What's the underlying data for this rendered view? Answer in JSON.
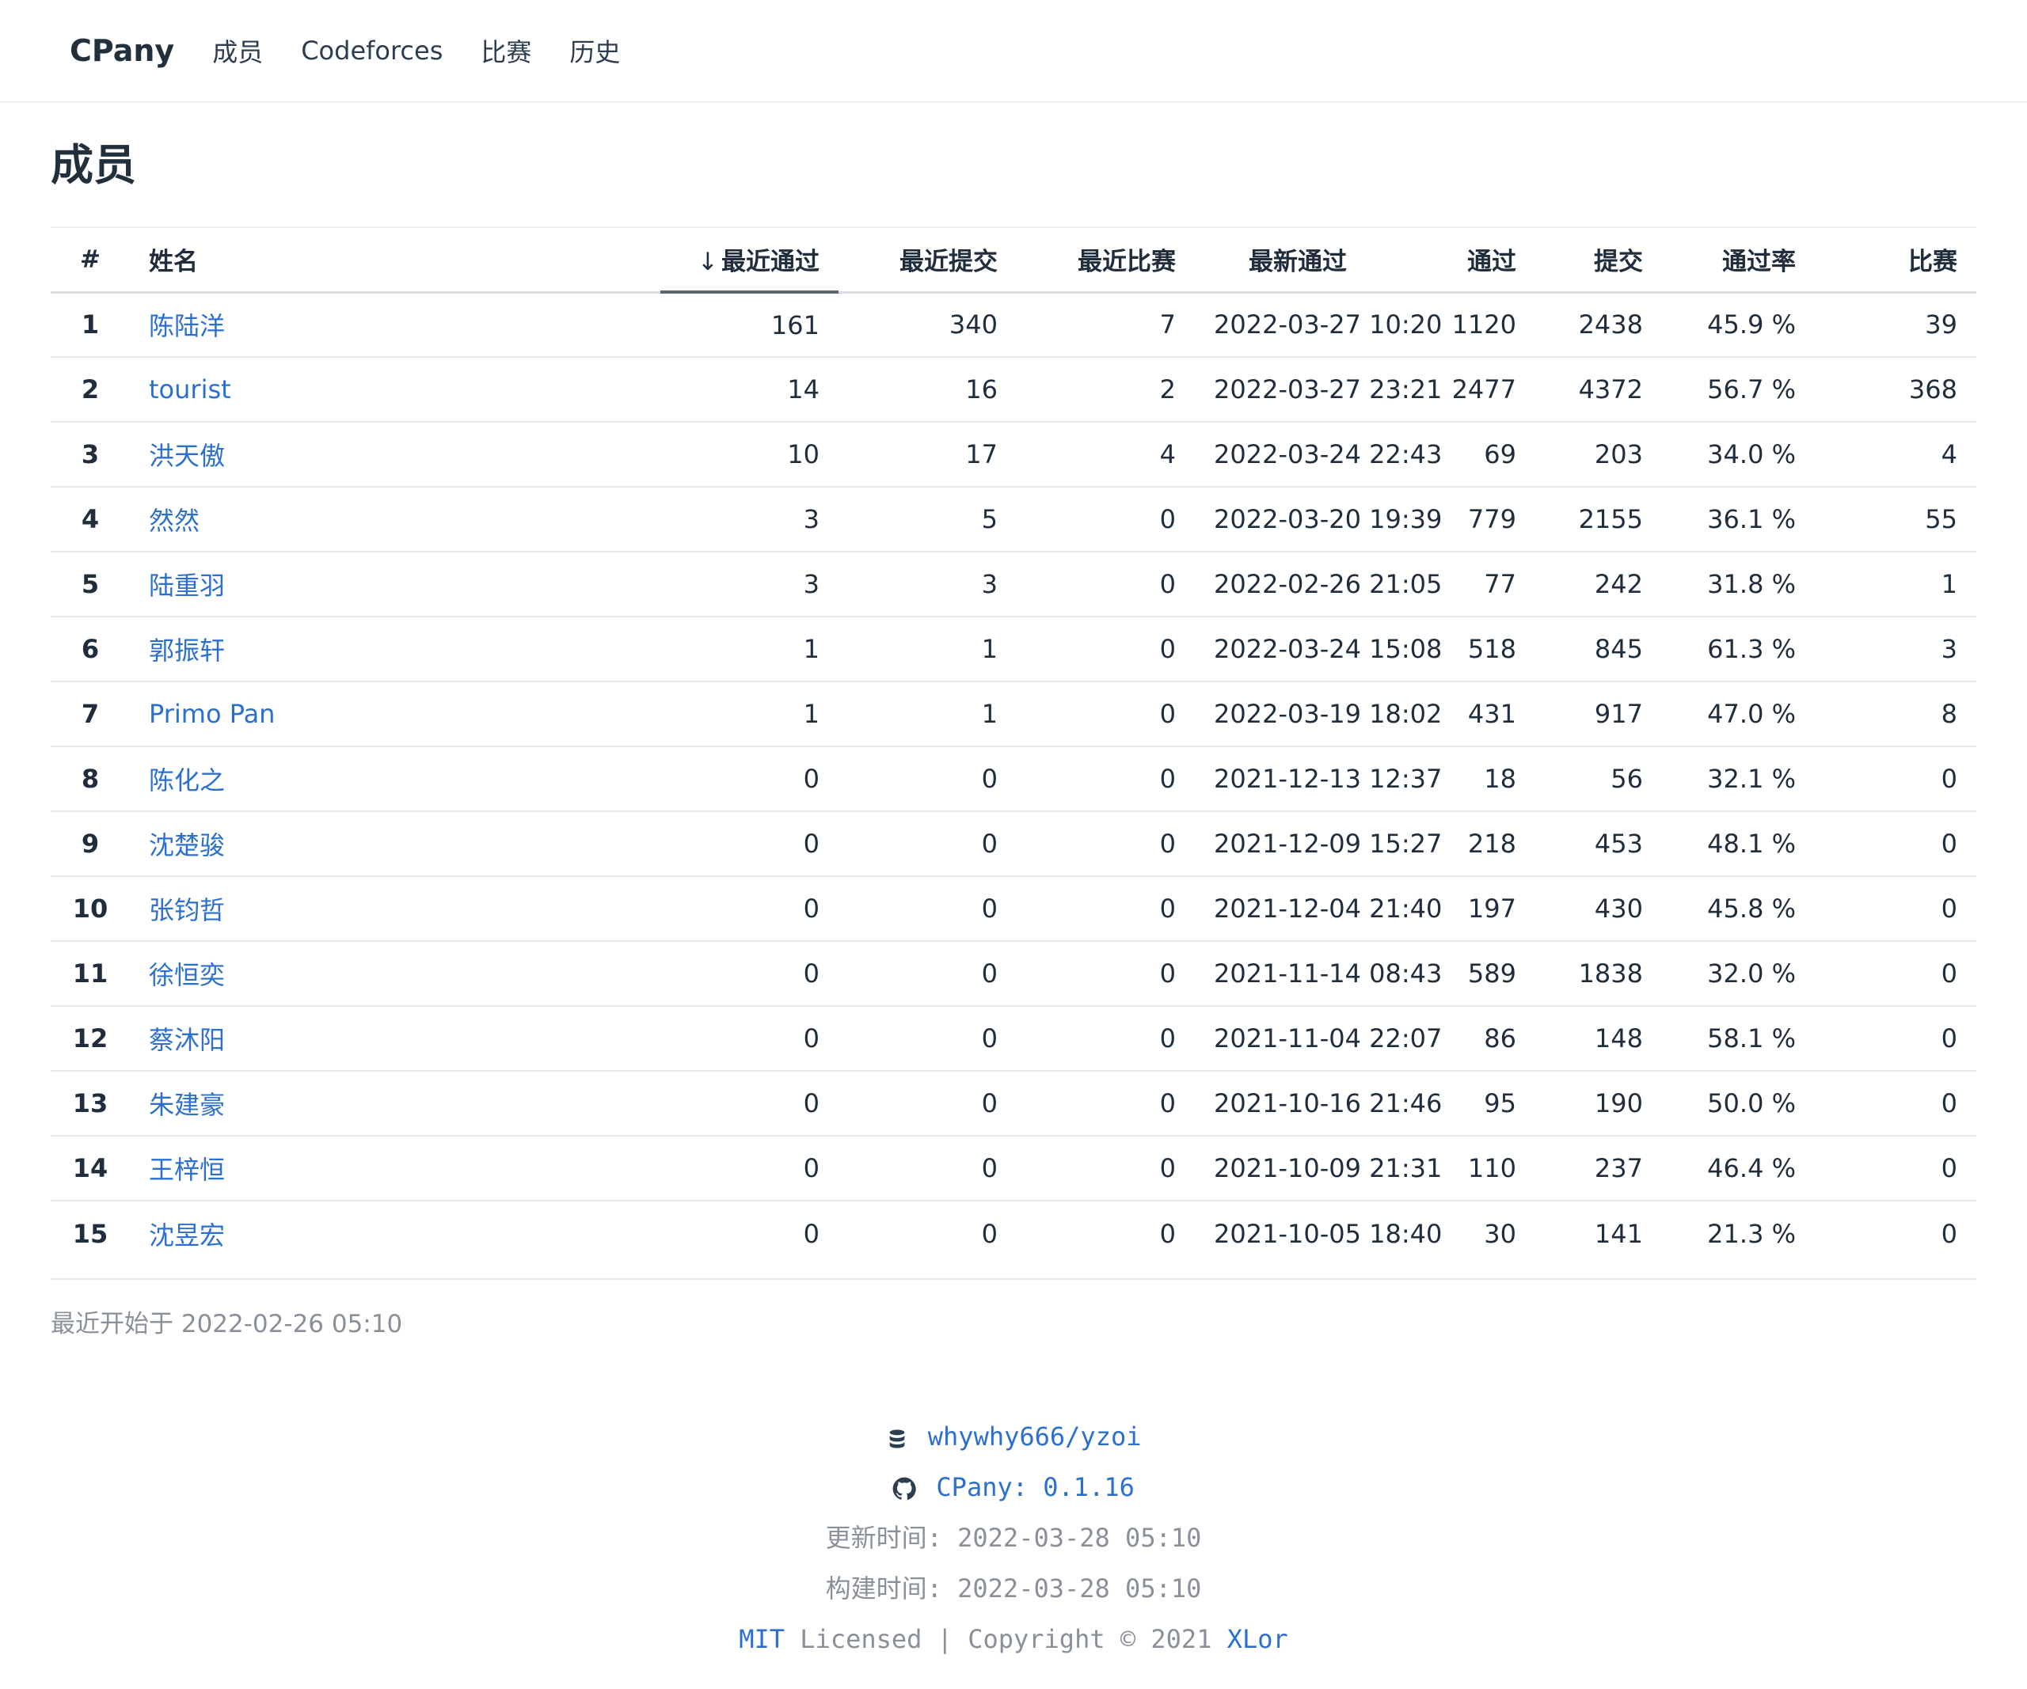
{
  "nav": {
    "brand": "CPany",
    "links": [
      "成员",
      "Codeforces",
      "比赛",
      "历史"
    ]
  },
  "page": {
    "title": "成员"
  },
  "table": {
    "headers": {
      "idx": "#",
      "name": "姓名",
      "recent_ac": "最近通过",
      "recent_submit": "最近提交",
      "recent_contest": "最近比赛",
      "latest_ac_time": "最新通过",
      "ac": "通过",
      "submit": "提交",
      "ac_rate": "通过率",
      "contests": "比赛"
    },
    "sort_arrow": "↓",
    "rows": [
      {
        "idx": "1",
        "name": "陈陆洋",
        "recent_ac": "161",
        "recent_submit": "340",
        "recent_contest": "7",
        "latest": "2022-03-27 10:20",
        "ac": "1120",
        "submit": "2438",
        "rate": "45.9 %",
        "contests": "39"
      },
      {
        "idx": "2",
        "name": "tourist",
        "recent_ac": "14",
        "recent_submit": "16",
        "recent_contest": "2",
        "latest": "2022-03-27 23:21",
        "ac": "2477",
        "submit": "4372",
        "rate": "56.7 %",
        "contests": "368"
      },
      {
        "idx": "3",
        "name": "洪天傲",
        "recent_ac": "10",
        "recent_submit": "17",
        "recent_contest": "4",
        "latest": "2022-03-24 22:43",
        "ac": "69",
        "submit": "203",
        "rate": "34.0 %",
        "contests": "4"
      },
      {
        "idx": "4",
        "name": "然然",
        "recent_ac": "3",
        "recent_submit": "5",
        "recent_contest": "0",
        "latest": "2022-03-20 19:39",
        "ac": "779",
        "submit": "2155",
        "rate": "36.1 %",
        "contests": "55"
      },
      {
        "idx": "5",
        "name": "陆重羽",
        "recent_ac": "3",
        "recent_submit": "3",
        "recent_contest": "0",
        "latest": "2022-02-26 21:05",
        "ac": "77",
        "submit": "242",
        "rate": "31.8 %",
        "contests": "1"
      },
      {
        "idx": "6",
        "name": "郭振轩",
        "recent_ac": "1",
        "recent_submit": "1",
        "recent_contest": "0",
        "latest": "2022-03-24 15:08",
        "ac": "518",
        "submit": "845",
        "rate": "61.3 %",
        "contests": "3"
      },
      {
        "idx": "7",
        "name": "Primo Pan",
        "recent_ac": "1",
        "recent_submit": "1",
        "recent_contest": "0",
        "latest": "2022-03-19 18:02",
        "ac": "431",
        "submit": "917",
        "rate": "47.0 %",
        "contests": "8"
      },
      {
        "idx": "8",
        "name": "陈化之",
        "recent_ac": "0",
        "recent_submit": "0",
        "recent_contest": "0",
        "latest": "2021-12-13 12:37",
        "ac": "18",
        "submit": "56",
        "rate": "32.1 %",
        "contests": "0"
      },
      {
        "idx": "9",
        "name": "沈楚骏",
        "recent_ac": "0",
        "recent_submit": "0",
        "recent_contest": "0",
        "latest": "2021-12-09 15:27",
        "ac": "218",
        "submit": "453",
        "rate": "48.1 %",
        "contests": "0"
      },
      {
        "idx": "10",
        "name": "张钧哲",
        "recent_ac": "0",
        "recent_submit": "0",
        "recent_contest": "0",
        "latest": "2021-12-04 21:40",
        "ac": "197",
        "submit": "430",
        "rate": "45.8 %",
        "contests": "0"
      },
      {
        "idx": "11",
        "name": "徐恒奕",
        "recent_ac": "0",
        "recent_submit": "0",
        "recent_contest": "0",
        "latest": "2021-11-14 08:43",
        "ac": "589",
        "submit": "1838",
        "rate": "32.0 %",
        "contests": "0"
      },
      {
        "idx": "12",
        "name": "蔡沐阳",
        "recent_ac": "0",
        "recent_submit": "0",
        "recent_contest": "0",
        "latest": "2021-11-04 22:07",
        "ac": "86",
        "submit": "148",
        "rate": "58.1 %",
        "contests": "0"
      },
      {
        "idx": "13",
        "name": "朱建豪",
        "recent_ac": "0",
        "recent_submit": "0",
        "recent_contest": "0",
        "latest": "2021-10-16 21:46",
        "ac": "95",
        "submit": "190",
        "rate": "50.0 %",
        "contests": "0"
      },
      {
        "idx": "14",
        "name": "王梓恒",
        "recent_ac": "0",
        "recent_submit": "0",
        "recent_contest": "0",
        "latest": "2021-10-09 21:31",
        "ac": "110",
        "submit": "237",
        "rate": "46.4 %",
        "contests": "0"
      },
      {
        "idx": "15",
        "name": "沈昱宏",
        "recent_ac": "0",
        "recent_submit": "0",
        "recent_contest": "0",
        "latest": "2021-10-05 18:40",
        "ac": "30",
        "submit": "141",
        "rate": "21.3 %",
        "contests": "0"
      }
    ]
  },
  "recent_start": "最近开始于 2022-02-26 05:10",
  "footer": {
    "repo": "whywhy666/yzoi",
    "version": "CPany: 0.1.16",
    "updated": "更新时间: 2022-03-28 05:10",
    "built": "构建时间: 2022-03-28 05:10",
    "license_link": "MIT",
    "license_text": " Licensed | Copyright © 2021 ",
    "author": "XLor"
  },
  "colors": {
    "link": "#2c70cf",
    "text": "#1f2d3d",
    "muted": "#8a9099"
  },
  "icons": {
    "repo": "database-icon",
    "version": "github-icon"
  }
}
